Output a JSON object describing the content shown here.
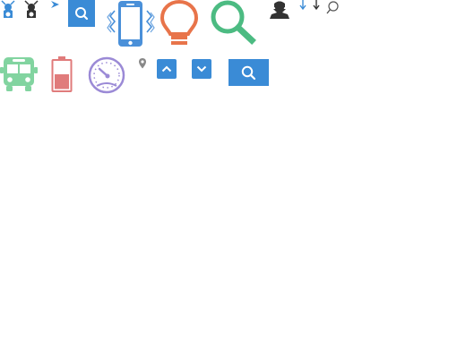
{
  "icons": [
    {
      "name": "wheelchair-icon",
      "color": "#3a8bd6"
    },
    {
      "name": "wheelchair-icon",
      "color": "#333333"
    },
    {
      "name": "arrow-right-icon",
      "color": "#3a8bd6"
    },
    {
      "name": "search-icon",
      "color": "#ffffff",
      "background": "#3a8bd6"
    },
    {
      "name": "phone-vibrate-icon",
      "color": "#4a90d9"
    },
    {
      "name": "lightbulb-icon",
      "color": "#e8744a"
    },
    {
      "name": "search-icon",
      "color": "#4cbb82"
    },
    {
      "name": "users-icon",
      "color": "#333333"
    },
    {
      "name": "sort-down-icon",
      "color": "#3a8bd6"
    },
    {
      "name": "sort-down-icon",
      "color": "#333333"
    },
    {
      "name": "search-icon",
      "color": "#555555"
    },
    {
      "name": "bus-icon",
      "color": "#82d4a0"
    },
    {
      "name": "battery-icon",
      "color": "#e07b7b"
    },
    {
      "name": "speedometer-icon",
      "color": "#9b8ad6"
    },
    {
      "name": "map-pin-icon",
      "color": "#888888"
    },
    {
      "name": "chevron-up-icon",
      "color": "#ffffff",
      "background": "#3a8bd6"
    },
    {
      "name": "chevron-down-icon",
      "color": "#ffffff",
      "background": "#3a8bd6"
    },
    {
      "name": "search-icon",
      "color": "#ffffff",
      "background": "#3a8bd6"
    }
  ],
  "battery_level": 0.55
}
